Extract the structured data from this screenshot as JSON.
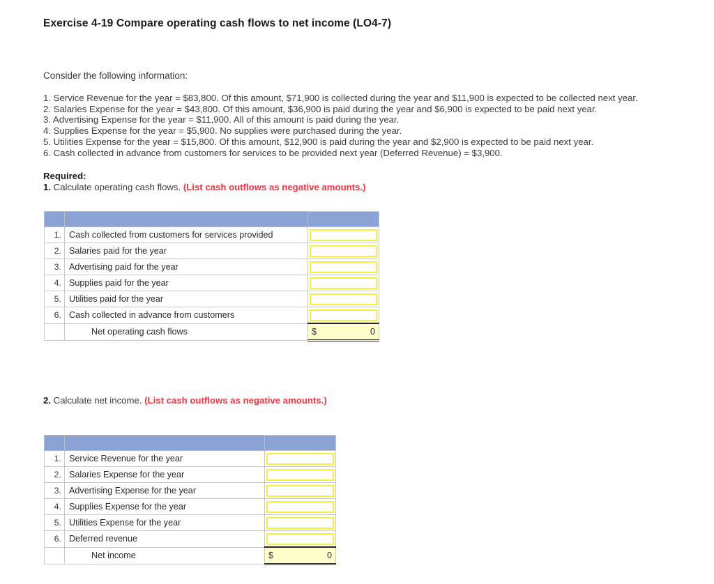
{
  "exercise": {
    "title": "Exercise 4-19 Compare operating cash flows to net income (LO4-7)"
  },
  "intro": {
    "lead": "Consider the following information:",
    "facts": [
      "1. Service Revenue for the year = $83,800. Of this amount, $71,900 is collected during the year and $11,900 is expected to be collected next year.",
      "2. Salaries Expense for the year = $43,800. Of this amount, $36,900 is paid during the year and $6,900 is expected to be paid next year.",
      "3. Advertising Expense for the year = $11,900. All of this amount is paid during the year.",
      "4. Supplies Expense for the year = $5,900. No supplies were purchased during the year.",
      "5. Utilities Expense for the year = $15,800. Of this amount, $12,900 is paid during the year and $2,900 is expected to be paid next year.",
      "6. Cash collected in advance from customers for services to be provided next year (Deferred Revenue) = $3,900."
    ]
  },
  "required": {
    "heading": "Required:",
    "part1": {
      "number": "1.",
      "text": " Calculate operating cash flows. ",
      "note": "(List cash outflows as negative amounts.)"
    },
    "part2": {
      "number": "2.",
      "text": " Calculate net income. ",
      "note": "(List cash outflows as negative amounts.)"
    }
  },
  "colors": {
    "header_blue": "#8ba3d4",
    "entry_yellow_border": "#f5f03c",
    "total_fill": "#ffffcc",
    "note_red": "#f5333f"
  },
  "table_operating_cash_flows": {
    "header": {
      "col_num": "",
      "col_label": "",
      "col_amount": ""
    },
    "rows": [
      {
        "num": "1.",
        "label": "Cash collected from customers for services provided",
        "value": ""
      },
      {
        "num": "2.",
        "label": "Salaries paid for the year",
        "value": ""
      },
      {
        "num": "3.",
        "label": "Advertising paid for the year",
        "value": ""
      },
      {
        "num": "4.",
        "label": "Supplies paid for the year",
        "value": ""
      },
      {
        "num": "5.",
        "label": "Utilities paid for the year",
        "value": ""
      },
      {
        "num": "6.",
        "label": "Cash collected in advance from customers",
        "value": ""
      }
    ],
    "total": {
      "num": "",
      "label": "Net operating cash flows",
      "currency": "$",
      "value": "0"
    }
  },
  "table_net_income": {
    "header": {
      "col_num": "",
      "col_label": "",
      "col_amount": ""
    },
    "rows": [
      {
        "num": "1.",
        "label": "Service Revenue for the year",
        "value": ""
      },
      {
        "num": "2.",
        "label": "Salaries Expense for the year",
        "value": ""
      },
      {
        "num": "3.",
        "label": "Advertising Expense for the year",
        "value": ""
      },
      {
        "num": "4.",
        "label": "Supplies Expense for the year",
        "value": ""
      },
      {
        "num": "5.",
        "label": "Utilities Expense for the year",
        "value": ""
      },
      {
        "num": "6.",
        "label": "Deferred revenue",
        "value": ""
      }
    ],
    "total": {
      "num": "",
      "label": "Net income",
      "currency": "$",
      "value": "0"
    }
  }
}
